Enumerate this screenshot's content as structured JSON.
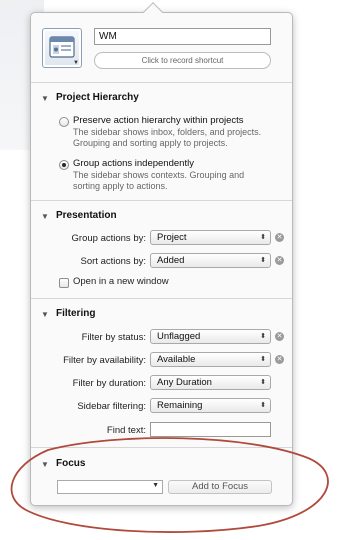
{
  "perspective": {
    "name_value": "WM",
    "shortcut_label": "Click to record shortcut",
    "icon": "perspective-window-icon"
  },
  "project_hierarchy": {
    "title": "Project Hierarchy",
    "options": [
      {
        "label": "Preserve action hierarchy within projects",
        "desc_line1": "The sidebar shows inbox, folders, and projects.",
        "desc_line2": "Grouping and sorting apply to projects.",
        "selected": false
      },
      {
        "label": "Group actions independently",
        "desc_line1": "The sidebar shows contexts. Grouping and",
        "desc_line2": "sorting apply to actions.",
        "selected": true
      }
    ]
  },
  "presentation": {
    "title": "Presentation",
    "group_label": "Group actions by:",
    "group_value": "Project",
    "sort_label": "Sort actions by:",
    "sort_value": "Added",
    "new_window_label": "Open in a new window",
    "new_window_checked": false
  },
  "filtering": {
    "title": "Filtering",
    "status_label": "Filter by status:",
    "status_value": "Unflagged",
    "availability_label": "Filter by availability:",
    "availability_value": "Available",
    "duration_label": "Filter by duration:",
    "duration_value": "Any Duration",
    "sidebar_label": "Sidebar filtering:",
    "sidebar_value": "Remaining",
    "find_label": "Find text:",
    "find_value": ""
  },
  "focus": {
    "title": "Focus",
    "combo_value": "",
    "add_button_label": "Add to Focus"
  },
  "colors": {
    "annotation": "#b04a3c",
    "panel_bg": "#fafafa",
    "border": "#b9b9b9"
  }
}
